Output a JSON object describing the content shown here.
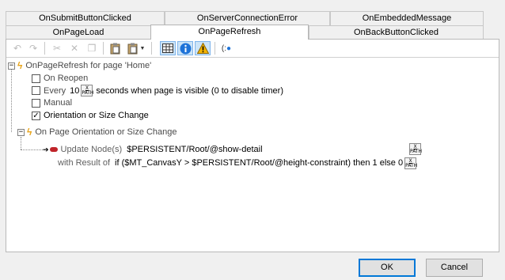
{
  "tabs": {
    "row1": [
      "OnSubmitButtonClicked",
      "OnServerConnectionError",
      "OnEmbeddedMessage"
    ],
    "row2": [
      "OnPageLoad",
      "OnPageRefresh",
      "OnBackButtonClicked"
    ],
    "active": "OnPageRefresh"
  },
  "toolbar": {
    "icons": [
      "undo-icon",
      "redo-icon",
      "cut-icon",
      "delete-icon",
      "copy-icon",
      "paste-icon",
      "paste-special-icon",
      "grid-view-icon",
      "info-icon",
      "warning-icon",
      "breakpoint-icon"
    ]
  },
  "tree": {
    "root_label": "OnPageRefresh for page 'Home'",
    "opt_reopen": "On Reopen",
    "opt_every_prefix": "Every",
    "opt_every_value": "10",
    "opt_every_suffix": "seconds when page is visible (0 to disable timer)",
    "opt_manual": "Manual",
    "opt_orientation": "Orientation or Size Change",
    "orientation_checked": true,
    "event_label": "On Page Orientation or Size Change",
    "action_label": "Update Node(s)",
    "action_target": "$PERSISTENT/Root/@show-detail",
    "result_label": "with Result of",
    "result_expr": "if ($MT_CanvasY > $PERSISTENT/Root/@height-constraint) then 1 else 0",
    "xpath_top": "X",
    "xpath_bottom": "PATH"
  },
  "buttons": {
    "ok": "OK",
    "cancel": "Cancel"
  }
}
